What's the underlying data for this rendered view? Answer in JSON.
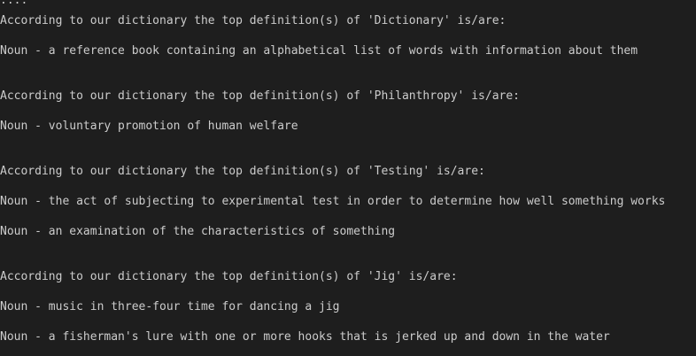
{
  "console": {
    "prefix": "....",
    "lines": [
      "According to our dictionary the top definition(s) of 'Dictionary' is/are:",
      "Noun - a reference book containing an alphabetical list of words with information about them",
      "According to our dictionary the top definition(s) of 'Philanthropy' is/are:",
      "Noun - voluntary promotion of human welfare",
      "According to our dictionary the top definition(s) of 'Testing' is/are:",
      "Noun - the act of subjecting to experimental test in order to determine how well something works",
      "Noun - an examination of the characteristics of something",
      "According to our dictionary the top definition(s) of 'Jig' is/are:",
      "Noun - music in three-four time for dancing a jig",
      "Noun - a fisherman's lure with one or more hooks that is jerked up and down in the water"
    ]
  },
  "colors": {
    "background": "#1e1e1e",
    "text": "#cccccc"
  }
}
